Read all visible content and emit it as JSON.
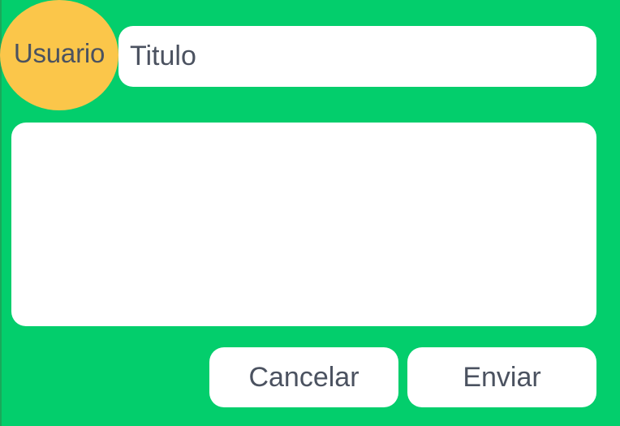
{
  "avatar": {
    "label": "Usuario"
  },
  "title_field": {
    "placeholder": "Titulo",
    "value": ""
  },
  "body_field": {
    "placeholder": "",
    "value": ""
  },
  "actions": {
    "cancel_label": "Cancelar",
    "send_label": "Enviar"
  },
  "colors": {
    "background": "#03ce6c",
    "avatar": "#fbc64a",
    "surface": "#ffffff",
    "text": "#4b5260"
  }
}
